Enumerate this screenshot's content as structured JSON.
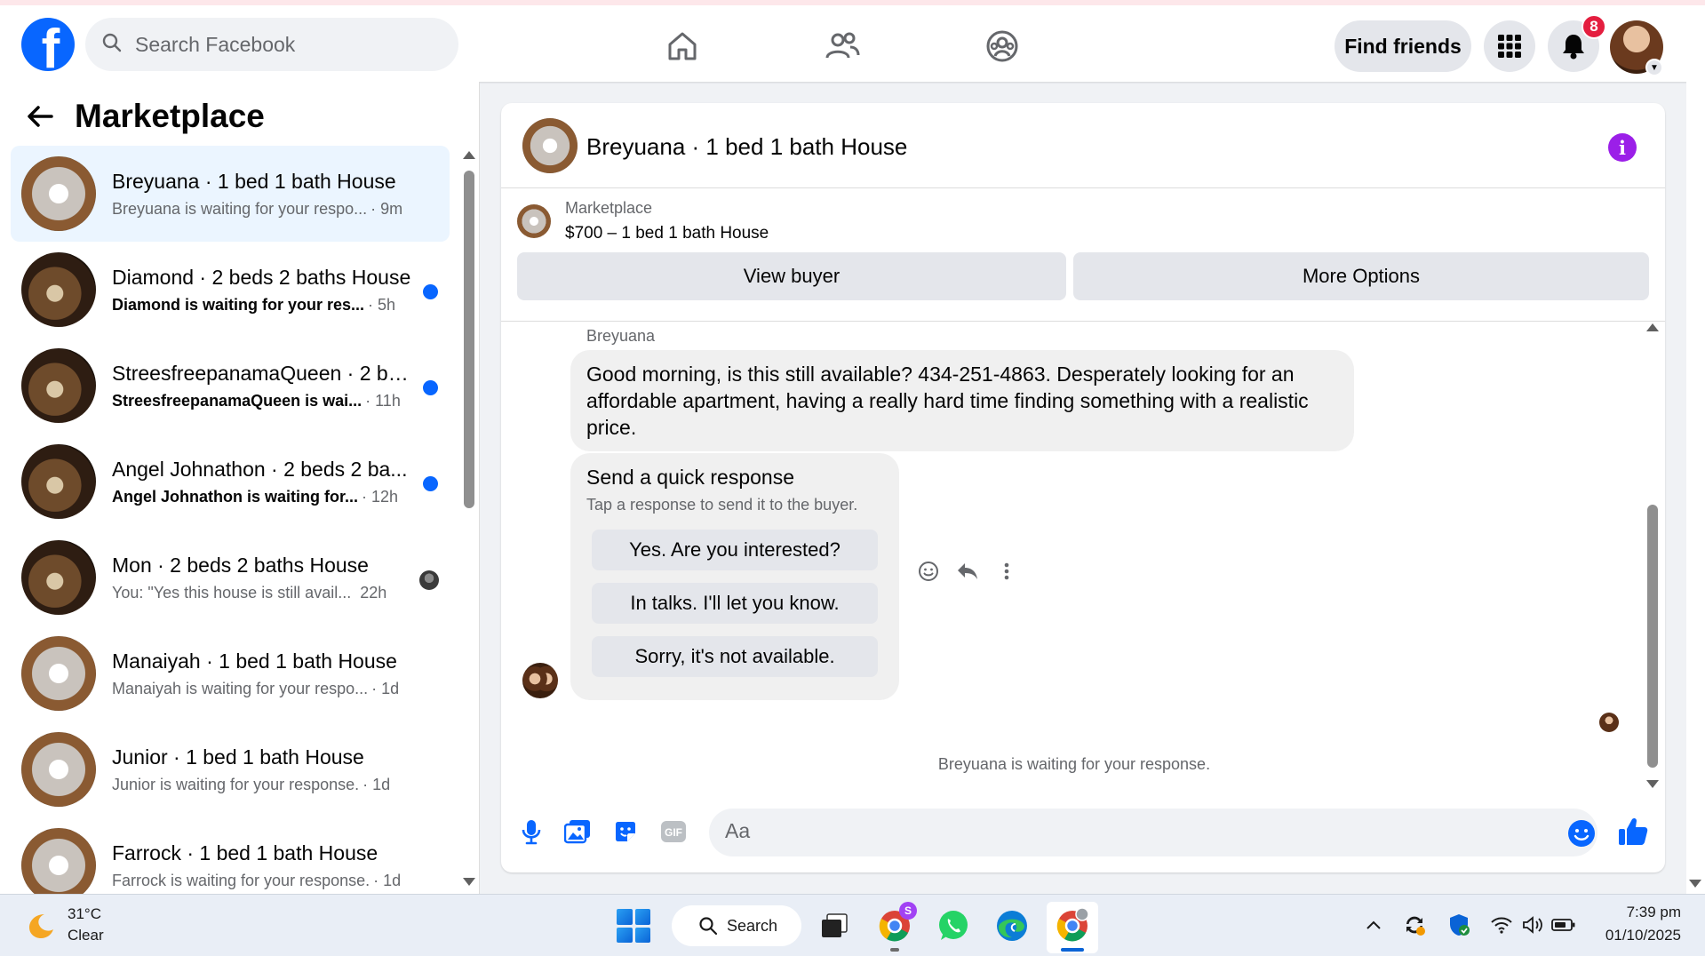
{
  "brand": {
    "accent": "#0866ff",
    "unread": "#0866ff",
    "badge": "#e41e3f",
    "info": "#9b1fe8"
  },
  "topnav": {
    "logo_letter": "f",
    "search_placeholder": "Search Facebook",
    "find_friends_label": "Find friends",
    "notifications_count": "8",
    "icons": [
      "home-icon",
      "friends-icon",
      "groups-icon",
      "menu-grid-icon",
      "bell-icon"
    ]
  },
  "sidebar": {
    "title": "Marketplace",
    "conversations": [
      {
        "name": "Breyuana · 1 bed 1 bath House",
        "snippet": "Breyuana is waiting for your respo...",
        "time": "· 9m",
        "unread": false,
        "active": true
      },
      {
        "name": "Diamond · 2 beds 2 baths House",
        "snippet": "Diamond is waiting for your res...",
        "time": "· 5h",
        "unread": true
      },
      {
        "name": "StreesfreepanamaQueen · 2 be...",
        "snippet": "StreesfreepanamaQueen is wai...",
        "time": "· 11h",
        "unread": true
      },
      {
        "name": "Angel Johnathon · 2 beds 2 ba...",
        "snippet": "Angel Johnathon is waiting for...",
        "time": "· 12h",
        "unread": true
      },
      {
        "name": "Mon · 2 beds 2 baths House",
        "snippet": "You: \"Yes this house is still avail...",
        "time": "22h",
        "unread": false,
        "seen": true
      },
      {
        "name": "Manaiyah · 1 bed 1 bath House",
        "snippet": "Manaiyah is waiting for your respo...",
        "time": "· 1d",
        "unread": false
      },
      {
        "name": "Junior · 1 bed 1 bath House",
        "snippet": "Junior is waiting for your response.",
        "time": "· 1d",
        "unread": false
      },
      {
        "name": "Farrock · 1 bed 1 bath House",
        "snippet": "Farrock is waiting for your response.",
        "time": "· 1d",
        "unread": false
      }
    ]
  },
  "chat": {
    "title": "Breyuana · 1 bed 1 bath House",
    "info_glyph": "i",
    "listing": {
      "source": "Marketplace",
      "title": "$700 – 1 bed 1 bath House"
    },
    "buttons": {
      "view_buyer": "View buyer",
      "more_options": "More Options"
    },
    "sender": "Breyuana",
    "message": "Good morning, is this still available? 434-251-4863. Desperately looking for an affordable apartment, having a really hard time finding something with a realistic price.",
    "quick_response": {
      "title": "Send a quick response",
      "subtitle": "Tap a response to send it to the buyer.",
      "options": [
        "Yes. Are you interested?",
        "In talks. I'll let you know.",
        "Sorry, it's not available."
      ]
    },
    "waiting_note": "Breyuana is waiting for your response.",
    "composer_placeholder": "Aa"
  },
  "taskbar": {
    "weather_temp": "31°C",
    "weather_condition": "Clear",
    "search_label": "Search",
    "time": "7:39 pm",
    "date": "01/10/2025",
    "chrome_profile_badge": "S"
  }
}
